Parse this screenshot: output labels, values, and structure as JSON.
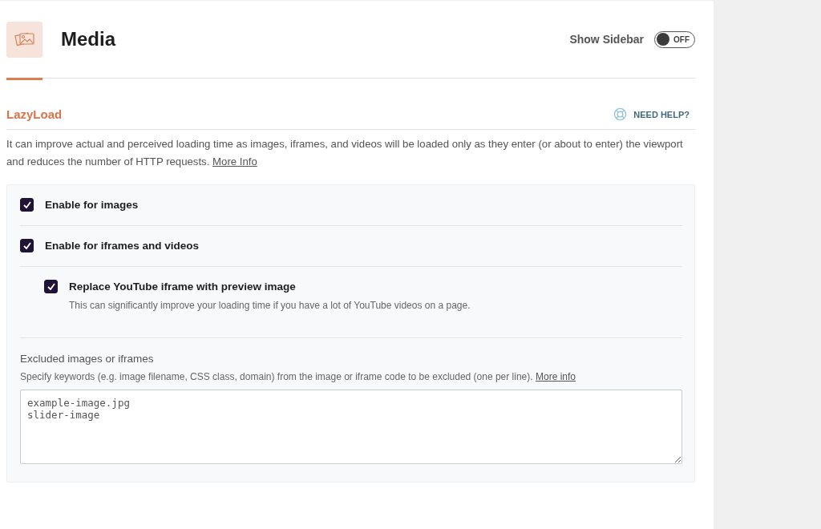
{
  "header": {
    "title": "Media",
    "sidebar_toggle": {
      "label": "Show Sidebar",
      "on": false,
      "state_text": "OFF"
    }
  },
  "section": {
    "title": "LazyLoad",
    "help": "NEED HELP?",
    "description": "It can improve actual and perceived loading time as images, iframes, and videos will be loaded only as they enter (or about to enter) the viewport and reduces the number of HTTP requests.",
    "description_link": "More Info",
    "options": [
      {
        "label": "Enable for images",
        "checked": true
      },
      {
        "label": "Enable for iframes and videos",
        "checked": true,
        "children": [
          {
            "label": "Replace YouTube iframe with preview image",
            "description": "This can significantly improve your loading time if you have a lot of YouTube videos on a page.",
            "checked": true
          }
        ]
      }
    ],
    "exclusions": {
      "label": "Excluded images or iframes",
      "description": "Specify keywords (e.g. image filename, CSS class, domain) from the image or iframe code to be excluded (one per line).",
      "link": "More info",
      "placeholder": "example-image.jpg\nslider-image"
    }
  }
}
